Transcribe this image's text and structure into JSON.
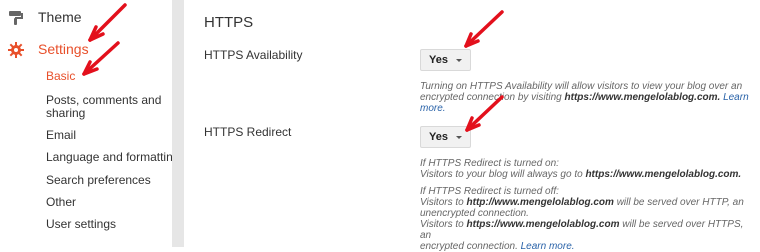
{
  "sidebar": {
    "theme_label": "Theme",
    "settings_label": "Settings",
    "sub_items": [
      "Basic",
      "Posts, comments and",
      "sharing",
      "Email",
      "Language and formatting",
      "Search preferences",
      "Other",
      "User settings"
    ],
    "active_color": "#e8502b"
  },
  "main": {
    "section_title": "HTTPS",
    "availability": {
      "label": "HTTPS Availability",
      "value": "Yes",
      "help_1": "Turning on HTTPS Availability will allow visitors to view your blog over an",
      "help_2_pre": "encrypted connection by visiting ",
      "help_2_url": "https://www.mengelolablog.com.",
      "help_2_link": "Learn more."
    },
    "redirect": {
      "label": "HTTPS Redirect",
      "value": "Yes",
      "on_1": "If HTTPS Redirect is turned on:",
      "on_2_pre": "Visitors to your blog will always go to ",
      "on_2_url": "https://www.mengelolablog.com.",
      "off_1": "If HTTPS Redirect is turned off:",
      "off_2_pre": "Visitors to ",
      "off_2_url": "http://www.mengelolablog.com",
      "off_2_post": " will be served over HTTP, an",
      "off_3": "unencrypted connection.",
      "off_4_pre": "Visitors to ",
      "off_4_url": "https://www.mengelolablog.com",
      "off_4_post": " will be served over HTTPS, an",
      "off_5_pre": "encrypted connection. ",
      "off_5_link": "Learn more."
    }
  },
  "annotation_color": "#e3101c"
}
